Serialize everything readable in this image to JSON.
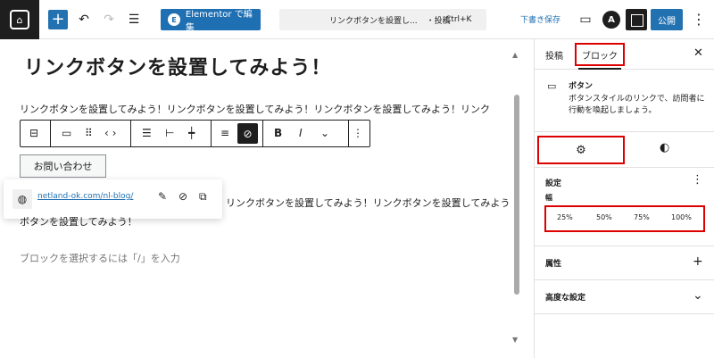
{
  "topbar": {
    "elementor_label": "Elementor で編集",
    "command_title": "リンクボタンを設置し...",
    "command_type": "・投稿",
    "command_shortcut": "Ctrl+K",
    "draft_label": "下書き保存",
    "publish_label": "公開",
    "plus_label": "+",
    "avatar_letter": "A"
  },
  "editor": {
    "title": "リンクボタンを設置してみよう！",
    "para1": "リンクボタンを設置してみよう！リンクボタンを設置してみよう！リンクボタンを設置してみよう！リンク",
    "button_label": "お問い合わせ",
    "link_url": "netland-ok.com/nl-blog/",
    "para2": "リンクボタンを設置してみよう！リンクボタンを設置してみよう！リンク",
    "para2b": "ボタンを設置してみよう！",
    "placeholder": "ブロックを選択するには「/」を入力"
  },
  "sidebar": {
    "tab_post": "投稿",
    "tab_block": "ブロック",
    "block_name": "ボタン",
    "block_desc": "ボタンスタイルのリンクで、訪問者に行動を喚起しましょう。",
    "settings_title": "設定",
    "width_label": "幅",
    "widths": [
      "25%",
      "50%",
      "75%",
      "100%"
    ],
    "attributes_label": "属性",
    "advanced_label": "高度な設定"
  },
  "colors": {
    "accent": "#2271b1",
    "highlight_red": "#dd0000",
    "dark": "#1e1e1e"
  }
}
